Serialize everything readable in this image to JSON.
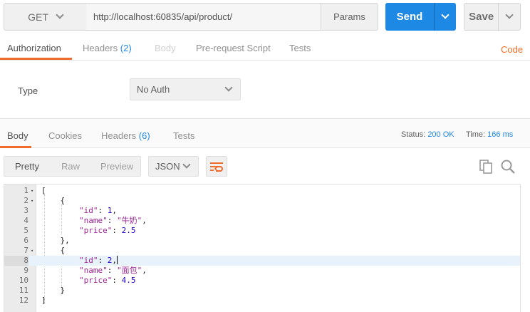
{
  "request": {
    "method": "GET",
    "url": "http://localhost:60835/api/product/",
    "params_label": "Params",
    "send_label": "Send",
    "save_label": "Save"
  },
  "request_tabs": {
    "authorization": "Authorization",
    "headers": "Headers",
    "headers_count": "(2)",
    "body": "Body",
    "prerequest": "Pre-request Script",
    "tests": "Tests",
    "code_link": "Code"
  },
  "auth": {
    "type_label": "Type",
    "type_value": "No Auth"
  },
  "response_tabs": {
    "body": "Body",
    "cookies": "Cookies",
    "headers": "Headers",
    "headers_count": "(6)",
    "tests": "Tests"
  },
  "response_meta": {
    "status_label": "Status:",
    "status_value": "200 OK",
    "time_label": "Time:",
    "time_value": "166 ms"
  },
  "response_toolbar": {
    "pretty": "Pretty",
    "raw": "Raw",
    "preview": "Preview",
    "format": "JSON"
  },
  "editor": {
    "active_line": 8,
    "lines": [
      {
        "n": "1",
        "fold": true,
        "tokens": [
          [
            "p",
            "["
          ]
        ]
      },
      {
        "n": "2",
        "fold": true,
        "tokens": [
          [
            "p",
            "    {"
          ]
        ]
      },
      {
        "n": "3",
        "fold": false,
        "tokens": [
          [
            "p",
            "        "
          ],
          [
            "k",
            "\"id\""
          ],
          [
            "p",
            ": "
          ],
          [
            "n",
            "1"
          ],
          [
            "p",
            ","
          ]
        ]
      },
      {
        "n": "4",
        "fold": false,
        "tokens": [
          [
            "p",
            "        "
          ],
          [
            "k",
            "\"name\""
          ],
          [
            "p",
            ": "
          ],
          [
            "s",
            "\"牛奶\""
          ],
          [
            "p",
            ","
          ]
        ]
      },
      {
        "n": "5",
        "fold": false,
        "tokens": [
          [
            "p",
            "        "
          ],
          [
            "k",
            "\"price\""
          ],
          [
            "p",
            ": "
          ],
          [
            "n",
            "2.5"
          ]
        ]
      },
      {
        "n": "6",
        "fold": false,
        "tokens": [
          [
            "p",
            "    },"
          ]
        ]
      },
      {
        "n": "7",
        "fold": true,
        "tokens": [
          [
            "p",
            "    {"
          ]
        ]
      },
      {
        "n": "8",
        "fold": false,
        "tokens": [
          [
            "p",
            "        "
          ],
          [
            "k",
            "\"id\""
          ],
          [
            "p",
            ": "
          ],
          [
            "n",
            "2"
          ],
          [
            "p",
            ","
          ]
        ]
      },
      {
        "n": "9",
        "fold": false,
        "tokens": [
          [
            "p",
            "        "
          ],
          [
            "k",
            "\"name\""
          ],
          [
            "p",
            ": "
          ],
          [
            "s",
            "\"面包\""
          ],
          [
            "p",
            ","
          ]
        ]
      },
      {
        "n": "10",
        "fold": false,
        "tokens": [
          [
            "p",
            "        "
          ],
          [
            "k",
            "\"price\""
          ],
          [
            "p",
            ": "
          ],
          [
            "n",
            "4.5"
          ]
        ]
      },
      {
        "n": "11",
        "fold": false,
        "tokens": [
          [
            "p",
            "    }"
          ]
        ]
      },
      {
        "n": "12",
        "fold": false,
        "tokens": [
          [
            "p",
            "]"
          ]
        ]
      }
    ]
  },
  "colors": {
    "accent_orange": "#f06c2a",
    "primary_blue": "#1e88e5"
  }
}
